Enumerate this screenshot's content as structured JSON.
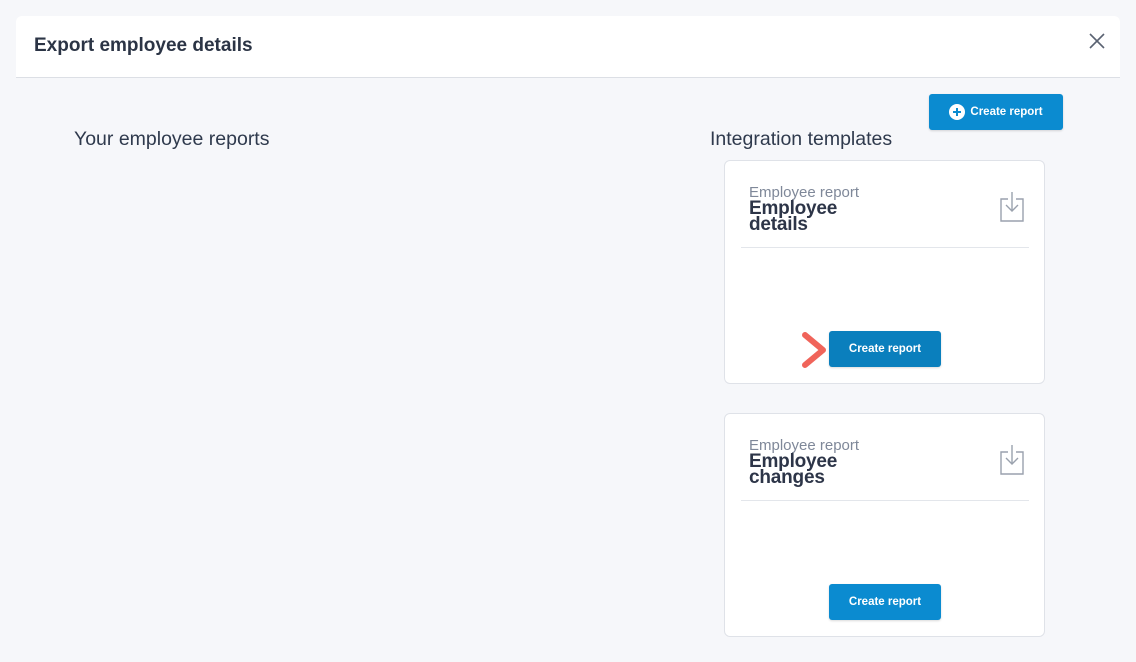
{
  "modal": {
    "title": "Export employee details"
  },
  "toolbar": {
    "create_report_label": "Create report"
  },
  "sections": {
    "your_reports_heading": "Your employee reports",
    "templates_heading": "Integration templates"
  },
  "templates": [
    {
      "subtitle": "Employee report",
      "title_line1": "Employee",
      "title_line2": "details",
      "button_label": "Create report"
    },
    {
      "subtitle": "Employee report",
      "title_line1": "Employee",
      "title_line2": "changes",
      "button_label": "Create report"
    }
  ],
  "colors": {
    "primary": "#0b8bd0",
    "highlight_arrow": "#f0645a",
    "title_text": "#2b3445"
  },
  "icons": {
    "close": "close-icon",
    "plus": "plus-circle-icon",
    "download": "download-icon",
    "pointer": "chevron-right-icon"
  }
}
